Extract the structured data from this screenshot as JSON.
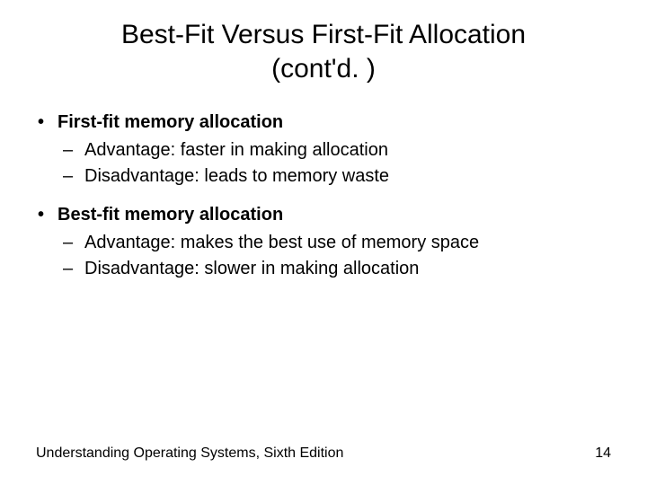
{
  "title_line1": "Best-Fit Versus First-Fit Allocation",
  "title_line2": "(cont'd. )",
  "sections": [
    {
      "heading": "First-fit memory allocation",
      "items": [
        "Advantage: faster in making allocation",
        "Disadvantage: leads to memory waste"
      ]
    },
    {
      "heading": "Best-fit memory allocation",
      "items": [
        "Advantage: makes the best use of memory space",
        "Disadvantage: slower in making allocation"
      ]
    }
  ],
  "footer_text": "Understanding Operating Systems, Sixth Edition",
  "page_number": "14"
}
